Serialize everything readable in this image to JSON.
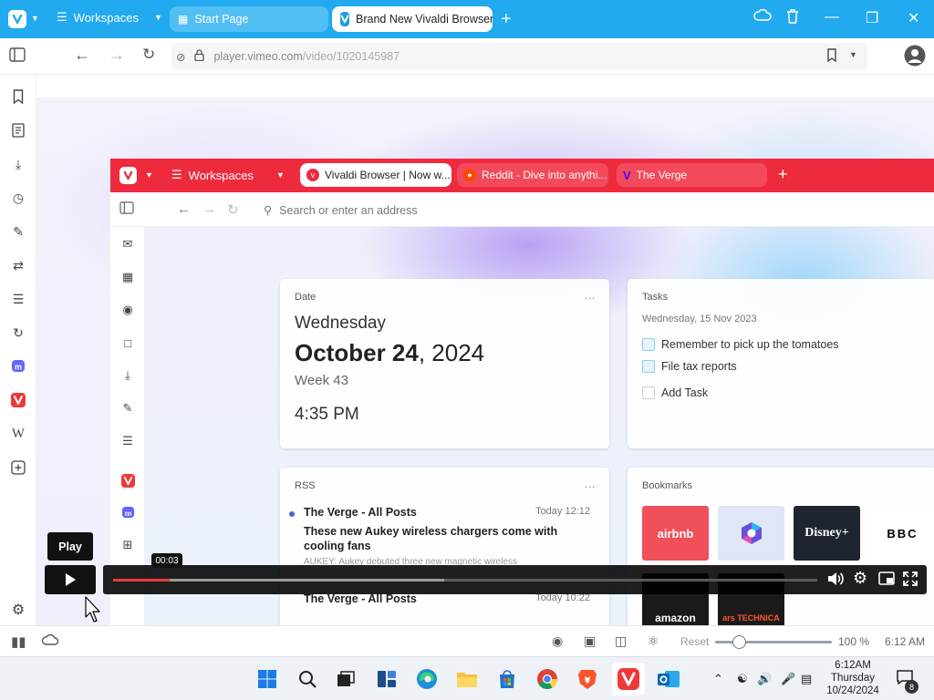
{
  "browser": {
    "workspaces_label": "Workspaces",
    "tabs": [
      {
        "label": "Start Page"
      },
      {
        "label": "Brand New Vivaldi Browser"
      }
    ],
    "new_tab": "+",
    "url_host": "player.vimeo.com",
    "url_path": "/video/1020145987",
    "brand_color": "#21aaf0"
  },
  "video_frame": {
    "workspaces_label": "Workspaces",
    "tabs": [
      {
        "label": "Vivaldi Browser | Now w..."
      },
      {
        "label": "Reddit - Dive into anythi..."
      },
      {
        "label": "The Verge"
      }
    ],
    "new_tab": "+",
    "search_placeholder": "Search or enter an address",
    "date_card": {
      "title": "Date",
      "weekday": "Wednesday",
      "month_day": "October 24",
      "year": ", 2024",
      "week": "Week 43",
      "time": "4:35 PM",
      "menu": "…"
    },
    "tasks_card": {
      "title": "Tasks",
      "date": "Wednesday, 15 Nov 2023",
      "items": [
        {
          "label": "Remember to pick up the tomatoes"
        },
        {
          "label": "File tax reports"
        }
      ],
      "add_label": "Add Task"
    },
    "rss_card": {
      "title": "RSS",
      "menu": "…",
      "feed": "The Verge -  All Posts",
      "time": "Today 12:12",
      "headline": "These new Aukey wireless chargers come with cooling fans",
      "snippet": "AUKEY: Aukey debuted three new magnetic wireless",
      "feed2": "The Verge -  All Posts",
      "time2": "Today 10:22"
    },
    "bookmarks_card": {
      "title": "Bookmarks",
      "items": [
        {
          "label": "airbnb",
          "color": "#f0505a"
        },
        {
          "label": "",
          "color": "#dfe6f5"
        },
        {
          "label": "Disney+",
          "color": "#1e2430"
        },
        {
          "label": "BBC",
          "color": "#ffffff"
        }
      ],
      "row2": [
        {
          "label": "amazon"
        },
        {
          "label": "ars TECHNICA"
        }
      ]
    }
  },
  "player": {
    "play_tooltip": "Play",
    "current_time": "00:03",
    "progress_fraction": 0.08,
    "loaded_fraction": 0.47,
    "accent": "#ee3a3a"
  },
  "status": {
    "reset_label": "Reset",
    "zoom": "100 %",
    "zoom_fraction": 0.2,
    "time": "6:12 AM"
  },
  "taskbar": {
    "clock_time": "6:12AM",
    "clock_day": "Thursday",
    "clock_date": "10/24/2024",
    "notification_count": "8"
  }
}
